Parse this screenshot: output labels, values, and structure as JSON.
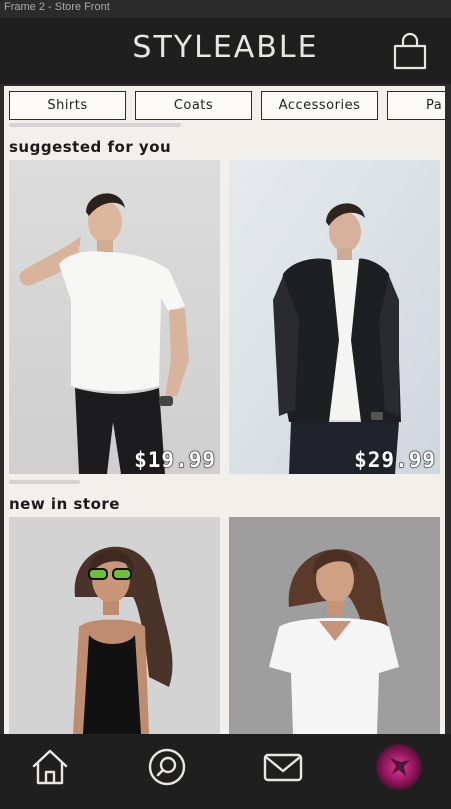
{
  "frame_label": "Frame 2 - Store Front",
  "header": {
    "logo": "STYLEABLE",
    "cart_icon": "shopping-bag-icon"
  },
  "categories": [
    {
      "label": "Shirts"
    },
    {
      "label": "Coats"
    },
    {
      "label": "Accessories"
    },
    {
      "label": "Pa"
    }
  ],
  "sections": {
    "suggested": {
      "title": "suggested for you",
      "items": [
        {
          "price": "$19.99",
          "image": "man in white t-shirt and black jeans"
        },
        {
          "price": "$29.99",
          "image": "man in black leather jacket"
        }
      ]
    },
    "new_in_store": {
      "title": "new in store",
      "items": [
        {
          "image": "woman in black tank top with green sunglasses"
        },
        {
          "image": "woman in white v-neck t-shirt"
        }
      ]
    }
  },
  "bottom_nav": [
    {
      "icon": "home-icon"
    },
    {
      "icon": "search-icon"
    },
    {
      "icon": "mail-icon"
    },
    {
      "icon": "profile-avatar"
    }
  ],
  "colors": {
    "bar_background": "#1f1f1f",
    "content_background": "#f2f0eb",
    "accent_avatar": "#c2187a"
  }
}
